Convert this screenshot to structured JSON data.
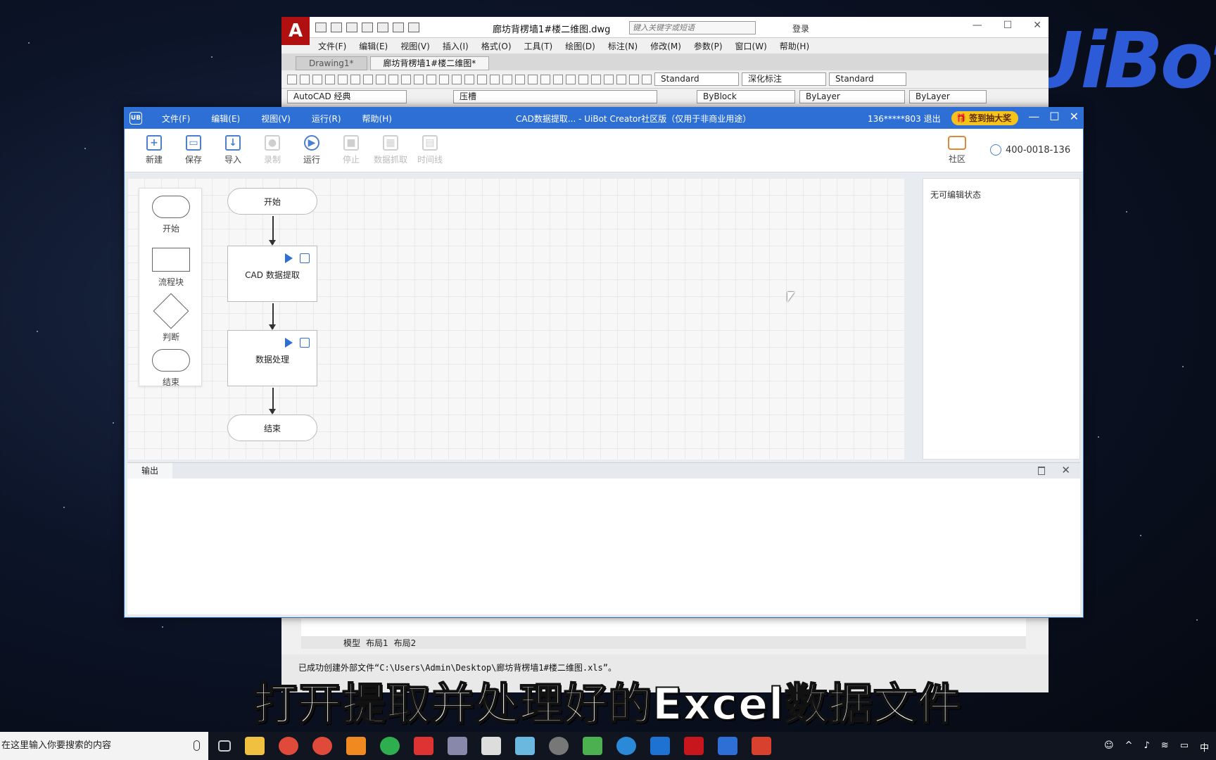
{
  "brand_logo": "UiBot",
  "cad": {
    "window_title": "廊坊背楞墙1#楼二维图.dwg",
    "search_placeholder": "键入关键字或短语",
    "login": "登录",
    "menus": [
      "文件(F)",
      "编辑(E)",
      "视图(V)",
      "插入(I)",
      "格式(O)",
      "工具(T)",
      "绘图(D)",
      "标注(N)",
      "修改(M)",
      "参数(P)",
      "窗口(W)",
      "帮助(H)"
    ],
    "tabs": [
      "Drawing1*",
      "廊坊背楞墙1#楼二维图*"
    ],
    "text_style": "Standard",
    "dim_style": "深化标注",
    "table_style": "Standard",
    "workspace": "AutoCAD 经典",
    "layer": "压槽",
    "color": "ByBlock",
    "linetype": "ByLayer",
    "lineweight": "ByLayer",
    "layout_tabs": [
      "模型",
      "布局1",
      "布局2"
    ],
    "status_message": "已成功创建外部文件“C:\\Users\\Admin\\Desktop\\廊坊背楞墙1#楼二维图.xls”。"
  },
  "ub": {
    "logo": "UB",
    "menus": [
      "文件(F)",
      "编辑(E)",
      "视图(V)",
      "运行(R)",
      "帮助(H)"
    ],
    "title": "CAD数据提取... - UiBot Creator社区版（仅用于非商业用途）",
    "user": "136*****803  退出",
    "prize": "签到抽大奖",
    "toolbar": {
      "new": "新建",
      "save": "保存",
      "import": "导入",
      "record": "录制",
      "run": "运行",
      "stop": "停止",
      "data_extract": "数据抓取",
      "timeline": "时间线"
    },
    "community": "社区",
    "phone": "400-0018-136",
    "palette": {
      "start": "开始",
      "block": "流程块",
      "decision": "判断",
      "end": "结束"
    },
    "flow": {
      "start": "开始",
      "block1": "CAD 数据提取",
      "block2": "数据处理",
      "end": "结束"
    },
    "props_text": "无可编辑状态",
    "output_tab": "输出"
  },
  "caption": "打开提取并处理好的Excel数据文件",
  "taskbar": {
    "search": "在这里输入你要搜索的内容",
    "ime": "中"
  }
}
